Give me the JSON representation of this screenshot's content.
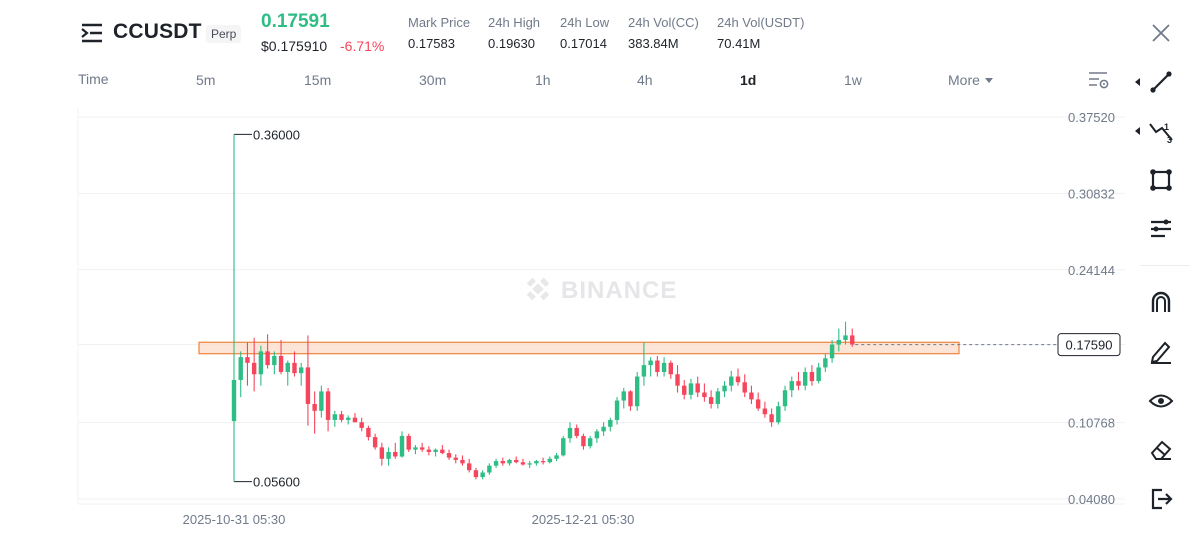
{
  "header": {
    "symbol": "CCUSDT",
    "contract_type": "Perp",
    "last_price": "0.17591",
    "usd_price": "$0.175910",
    "change_pct": "-6.71%",
    "stats": [
      {
        "label": "Mark Price",
        "value": "0.17583"
      },
      {
        "label": "24h High",
        "value": "0.19630"
      },
      {
        "label": "24h Low",
        "value": "0.17014"
      },
      {
        "label": "24h Vol(CC)",
        "value": "383.84M"
      },
      {
        "label": "24h Vol(USDT)",
        "value": "70.41M"
      }
    ]
  },
  "intervals": {
    "time_label": "Time",
    "items": [
      "5m",
      "15m",
      "30m",
      "1h",
      "4h",
      "1d",
      "1w"
    ],
    "active": "1d",
    "more_label": "More"
  },
  "chart_data": {
    "type": "candlestick",
    "watermark": "BINANCE",
    "y_ticks": [
      "0.37520",
      "0.30832",
      "0.24144",
      "0.17590",
      "0.10768",
      "0.04080"
    ],
    "x_ticks": [
      "2025-10-31 05:30",
      "2025-12-21 05:30"
    ],
    "current_price_label": "0.17590",
    "high_annotation": "0.36000",
    "low_annotation": "0.05600",
    "resistance_zone": [
      0.168,
      0.178
    ],
    "colors": {
      "up": "#2ebd85",
      "down": "#f6465d",
      "zone_fill": "#fbdcc8",
      "zone_stroke": "#f0843c"
    },
    "candles": [
      [
        0.109,
        0.36,
        0.056,
        0.145
      ],
      [
        0.145,
        0.17,
        0.13,
        0.165
      ],
      [
        0.165,
        0.178,
        0.14,
        0.16
      ],
      [
        0.16,
        0.182,
        0.135,
        0.15
      ],
      [
        0.15,
        0.175,
        0.14,
        0.17
      ],
      [
        0.17,
        0.185,
        0.155,
        0.158
      ],
      [
        0.158,
        0.17,
        0.15,
        0.166
      ],
      [
        0.166,
        0.18,
        0.15,
        0.152
      ],
      [
        0.152,
        0.162,
        0.14,
        0.16
      ],
      [
        0.16,
        0.17,
        0.148,
        0.151
      ],
      [
        0.151,
        0.16,
        0.14,
        0.156
      ],
      [
        0.156,
        0.184,
        0.105,
        0.124
      ],
      [
        0.124,
        0.135,
        0.098,
        0.118
      ],
      [
        0.118,
        0.14,
        0.112,
        0.135
      ],
      [
        0.135,
        0.138,
        0.1,
        0.11
      ],
      [
        0.11,
        0.118,
        0.104,
        0.115
      ],
      [
        0.115,
        0.118,
        0.108,
        0.11
      ],
      [
        0.11,
        0.114,
        0.106,
        0.112
      ],
      [
        0.112,
        0.116,
        0.108,
        0.108
      ],
      [
        0.108,
        0.112,
        0.1,
        0.103
      ],
      [
        0.103,
        0.105,
        0.092,
        0.095
      ],
      [
        0.095,
        0.098,
        0.084,
        0.086
      ],
      [
        0.086,
        0.09,
        0.07,
        0.076
      ],
      [
        0.076,
        0.086,
        0.07,
        0.082
      ],
      [
        0.082,
        0.09,
        0.076,
        0.078
      ],
      [
        0.078,
        0.1,
        0.077,
        0.096
      ],
      [
        0.096,
        0.098,
        0.082,
        0.084
      ],
      [
        0.084,
        0.088,
        0.08,
        0.086
      ],
      [
        0.086,
        0.09,
        0.082,
        0.084
      ],
      [
        0.084,
        0.087,
        0.079,
        0.082
      ],
      [
        0.082,
        0.085,
        0.078,
        0.084
      ],
      [
        0.084,
        0.088,
        0.08,
        0.081
      ],
      [
        0.081,
        0.084,
        0.075,
        0.077
      ],
      [
        0.077,
        0.08,
        0.072,
        0.075
      ],
      [
        0.075,
        0.079,
        0.07,
        0.072
      ],
      [
        0.072,
        0.076,
        0.064,
        0.066
      ],
      [
        0.066,
        0.068,
        0.058,
        0.06
      ],
      [
        0.06,
        0.066,
        0.058,
        0.064
      ],
      [
        0.064,
        0.072,
        0.062,
        0.07
      ],
      [
        0.07,
        0.076,
        0.068,
        0.074
      ],
      [
        0.074,
        0.077,
        0.07,
        0.072
      ],
      [
        0.072,
        0.076,
        0.07,
        0.075
      ],
      [
        0.075,
        0.078,
        0.072,
        0.073
      ],
      [
        0.073,
        0.076,
        0.07,
        0.071
      ],
      [
        0.071,
        0.074,
        0.068,
        0.072
      ],
      [
        0.072,
        0.075,
        0.07,
        0.074
      ],
      [
        0.074,
        0.077,
        0.071,
        0.073
      ],
      [
        0.073,
        0.078,
        0.072,
        0.076
      ],
      [
        0.076,
        0.081,
        0.074,
        0.079
      ],
      [
        0.079,
        0.096,
        0.078,
        0.094
      ],
      [
        0.094,
        0.108,
        0.09,
        0.103
      ],
      [
        0.103,
        0.106,
        0.094,
        0.096
      ],
      [
        0.096,
        0.098,
        0.084,
        0.087
      ],
      [
        0.087,
        0.096,
        0.085,
        0.094
      ],
      [
        0.094,
        0.102,
        0.09,
        0.1
      ],
      [
        0.1,
        0.108,
        0.096,
        0.104
      ],
      [
        0.104,
        0.112,
        0.1,
        0.11
      ],
      [
        0.11,
        0.13,
        0.106,
        0.127
      ],
      [
        0.127,
        0.138,
        0.12,
        0.135
      ],
      [
        0.135,
        0.136,
        0.118,
        0.122
      ],
      [
        0.122,
        0.152,
        0.118,
        0.148
      ],
      [
        0.148,
        0.178,
        0.14,
        0.158
      ],
      [
        0.158,
        0.165,
        0.148,
        0.162
      ],
      [
        0.162,
        0.166,
        0.148,
        0.152
      ],
      [
        0.152,
        0.165,
        0.148,
        0.16
      ],
      [
        0.16,
        0.162,
        0.146,
        0.15
      ],
      [
        0.15,
        0.158,
        0.134,
        0.14
      ],
      [
        0.14,
        0.145,
        0.128,
        0.132
      ],
      [
        0.132,
        0.146,
        0.128,
        0.142
      ],
      [
        0.142,
        0.148,
        0.13,
        0.134
      ],
      [
        0.134,
        0.142,
        0.126,
        0.13
      ],
      [
        0.13,
        0.136,
        0.12,
        0.124
      ],
      [
        0.124,
        0.138,
        0.12,
        0.135
      ],
      [
        0.135,
        0.144,
        0.13,
        0.14
      ],
      [
        0.14,
        0.153,
        0.135,
        0.148
      ],
      [
        0.148,
        0.155,
        0.14,
        0.143
      ],
      [
        0.143,
        0.15,
        0.13,
        0.134
      ],
      [
        0.134,
        0.14,
        0.124,
        0.128
      ],
      [
        0.128,
        0.134,
        0.118,
        0.12
      ],
      [
        0.12,
        0.126,
        0.112,
        0.115
      ],
      [
        0.115,
        0.12,
        0.104,
        0.108
      ],
      [
        0.108,
        0.126,
        0.106,
        0.122
      ],
      [
        0.122,
        0.14,
        0.118,
        0.136
      ],
      [
        0.136,
        0.148,
        0.13,
        0.144
      ],
      [
        0.144,
        0.152,
        0.136,
        0.14
      ],
      [
        0.14,
        0.156,
        0.136,
        0.152
      ],
      [
        0.152,
        0.158,
        0.14,
        0.144
      ],
      [
        0.144,
        0.16,
        0.142,
        0.156
      ],
      [
        0.156,
        0.168,
        0.152,
        0.164
      ],
      [
        0.164,
        0.18,
        0.16,
        0.176
      ],
      [
        0.176,
        0.19,
        0.17,
        0.18
      ],
      [
        0.18,
        0.196,
        0.176,
        0.184
      ],
      [
        0.184,
        0.19,
        0.174,
        0.176
      ]
    ]
  },
  "toolbar": {
    "tools": [
      "trend-line-icon",
      "fib-icon",
      "rectangle-icon",
      "parallel-lines-icon",
      "magnet-icon",
      "pencil-icon",
      "eye-icon",
      "eraser-icon",
      "exit-icon"
    ]
  }
}
